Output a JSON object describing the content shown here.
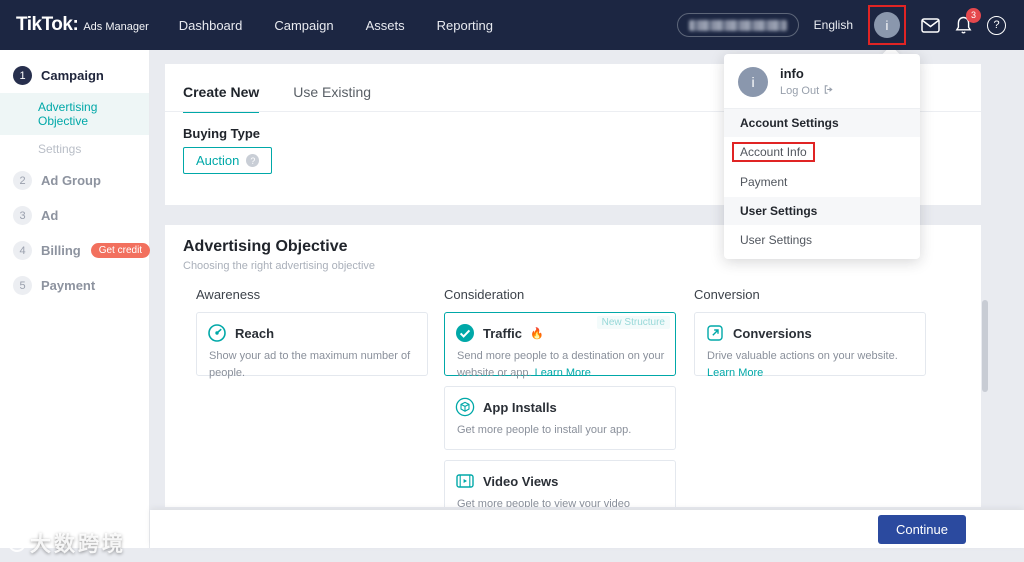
{
  "topbar": {
    "logo_main": "TikTok:",
    "logo_suffix": "Ads Manager",
    "nav": [
      {
        "label": "Dashboard"
      },
      {
        "label": "Campaign"
      },
      {
        "label": "Assets"
      },
      {
        "label": "Reporting"
      }
    ],
    "language_label": "English",
    "avatar_initial": "i",
    "notification_count": "3"
  },
  "sidebar": {
    "steps": [
      {
        "num": "1",
        "label": "Campaign"
      },
      {
        "num": "2",
        "label": "Ad Group"
      },
      {
        "num": "3",
        "label": "Ad"
      },
      {
        "num": "4",
        "label": "Billing"
      },
      {
        "num": "5",
        "label": "Payment"
      }
    ],
    "billing_badge": "Get credit",
    "campaign_children": [
      {
        "label": "Advertising Objective"
      },
      {
        "label": "Settings"
      }
    ]
  },
  "main": {
    "tabs": {
      "create_new": "Create New",
      "use_existing": "Use Existing"
    },
    "buying_type_label": "Buying Type",
    "auction_button_label": "Auction",
    "objective_title": "Advertising Objective",
    "objective_subtitle": "Choosing the right advertising objective",
    "column_headers": {
      "awareness": "Awareness",
      "consideration": "Consideration",
      "conversion": "Conversion"
    },
    "cards": {
      "reach": {
        "title": "Reach",
        "description": "Show your ad to the maximum number of people."
      },
      "traffic": {
        "title": "Traffic",
        "emoji": "🔥",
        "badge": "New Structure",
        "description": "Send more people to a destination on your website or app.",
        "link": "Learn More"
      },
      "app_installs": {
        "title": "App Installs",
        "description": "Get more people to install your app."
      },
      "video_views": {
        "title": "Video Views",
        "description": "Get more people to view your video"
      },
      "conversions": {
        "title": "Conversions",
        "description": "Drive valuable actions on your website.",
        "link": "Learn More"
      }
    },
    "continue_label": "Continue"
  },
  "dropdown": {
    "user_name": "info",
    "user_initial": "i",
    "logout_label": "Log Out",
    "account_settings_header": "Account Settings",
    "account_info_label": "Account Info",
    "payment_label": "Payment",
    "user_settings_header": "User Settings",
    "user_settings_item": "User Settings"
  },
  "watermark_text": "大数跨境",
  "colors": {
    "accent_teal": "#00a8a8",
    "topbar_bg": "#1c2642",
    "continue_blue": "#2b4a9f",
    "get_credit_red": "#f2705e",
    "annotation_red": "#e02424",
    "notification_red": "#e5484d"
  }
}
